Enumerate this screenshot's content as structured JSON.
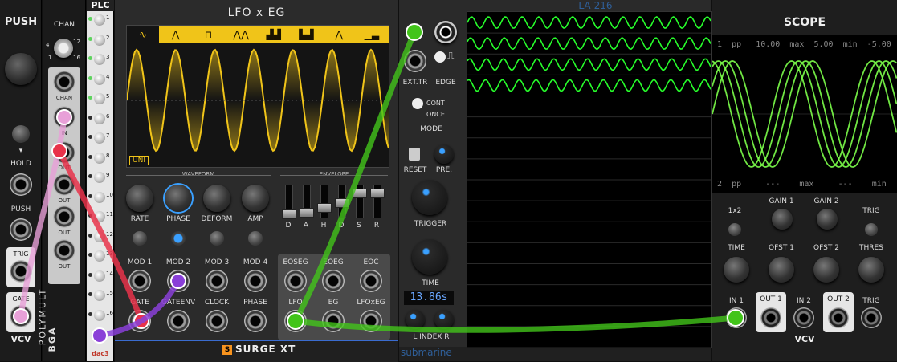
{
  "push": {
    "title": "PUSH",
    "hold": "HOLD",
    "push": "PUSH",
    "trig": "TRIG",
    "gate": "GATE",
    "brand": "VCV"
  },
  "polymult": {
    "chan": "CHAN",
    "ticks": [
      "1",
      "4",
      "12",
      "16"
    ],
    "chan_label": "CHAN",
    "in": "IN",
    "outs": [
      "OUT",
      "OUT",
      "OUT",
      "OUT"
    ],
    "name": "POLYMULT",
    "brand": "BGA"
  },
  "plc": {
    "title": "PLC",
    "rows": [
      "1",
      "2",
      "3",
      "4",
      "5",
      "6",
      "7",
      "8",
      "9",
      "10",
      "11",
      "12",
      "13",
      "14",
      "15",
      "16"
    ],
    "brand": "dac3"
  },
  "lfo": {
    "title": "LFO x EG",
    "wave_icons": [
      "∿",
      "⋀",
      "⊓",
      "⋀⋀",
      "▟▟",
      "▙▟",
      "⋀",
      "▁▃"
    ],
    "uni": "UNI",
    "waveform_section": "WAVEFORM",
    "envelope_section": "ENVELOPE",
    "knobs": [
      "RATE",
      "PHASE",
      "DEFORM",
      "AMP"
    ],
    "faders": [
      "D",
      "A",
      "H",
      "D",
      "S",
      "R"
    ],
    "mods": [
      "MOD 1",
      "MOD 2",
      "MOD 3",
      "MOD 4"
    ],
    "gates": [
      "GATE",
      "GATEENV",
      "CLOCK",
      "PHASE"
    ],
    "env_out_top": [
      "EOSEG",
      "EOEG",
      "EOC"
    ],
    "env_out_bottom": [
      "LFO",
      "EG",
      "LFOxEG"
    ],
    "brand": "SURGE XT",
    "colors": {
      "wave": "#f0c419",
      "bg": "#1e1e1e",
      "accent": "#3aa0ff"
    }
  },
  "la216": {
    "title": "LA-216",
    "ext_tr": "EXT.TR",
    "edge": "EDGE",
    "cont": "CONT",
    "once": "ONCE",
    "mode": "MODE",
    "reset": "RESET",
    "pre": "PRE.",
    "trigger": "TRIGGER",
    "time": "TIME",
    "time_value": "13.86s",
    "index": "L INDEX R",
    "brand": "submarine",
    "colors": {
      "trace": "#27ff2b"
    }
  },
  "scope": {
    "title": "SCOPE",
    "row1": {
      "ch": "1",
      "pp": "pp",
      "val": "10.00",
      "max_l": "max",
      "max": "5.00",
      "min_l": "min",
      "min": "-5.00"
    },
    "row2": {
      "ch": "2",
      "pp": "pp",
      "val": "---",
      "max_l": "max",
      "max": "---",
      "min_l": "min",
      "min": "---"
    },
    "x1x2": "1x2",
    "gain1": "GAIN 1",
    "gain2": "GAIN 2",
    "trig": "TRIG",
    "time": "TIME",
    "ofst1": "OFST 1",
    "ofst2": "OFST 2",
    "thres": "THRES",
    "in1": "IN 1",
    "out1": "OUT 1",
    "in2": "IN 2",
    "out2": "OUT 2",
    "trig_in": "TRIG",
    "brand": "VCV",
    "colors": {
      "trace": "#7cff4a"
    }
  }
}
